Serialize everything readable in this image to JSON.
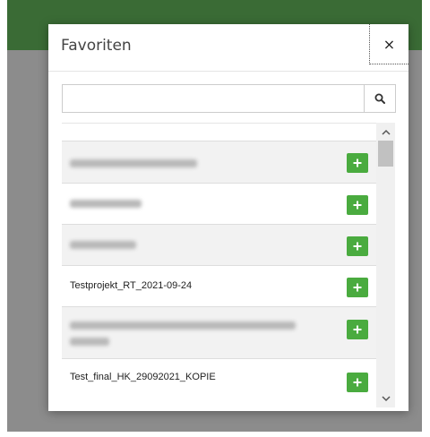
{
  "page": {
    "topbar_color": "#3a6b35",
    "overlay_color": "#8c8c8c"
  },
  "modal": {
    "title": "Favoriten",
    "close_label": "×",
    "search": {
      "value": "",
      "placeholder": ""
    },
    "icons": {
      "search": "search-icon",
      "close": "close-icon",
      "add": "plus-icon",
      "scroll_up": "chevron-up-icon",
      "scroll_down": "chevron-down-icon"
    },
    "accent_color": "#4aab3f",
    "items": [
      {
        "label": "",
        "obscured": true
      },
      {
        "label": "",
        "obscured": true
      },
      {
        "label": "",
        "obscured": true
      },
      {
        "label": "Testprojekt_RT_2021-09-24",
        "obscured": false
      },
      {
        "label": "",
        "obscured": true
      },
      {
        "label": "Test_final_HK_29092021_KOPIE",
        "obscured": false
      }
    ]
  }
}
